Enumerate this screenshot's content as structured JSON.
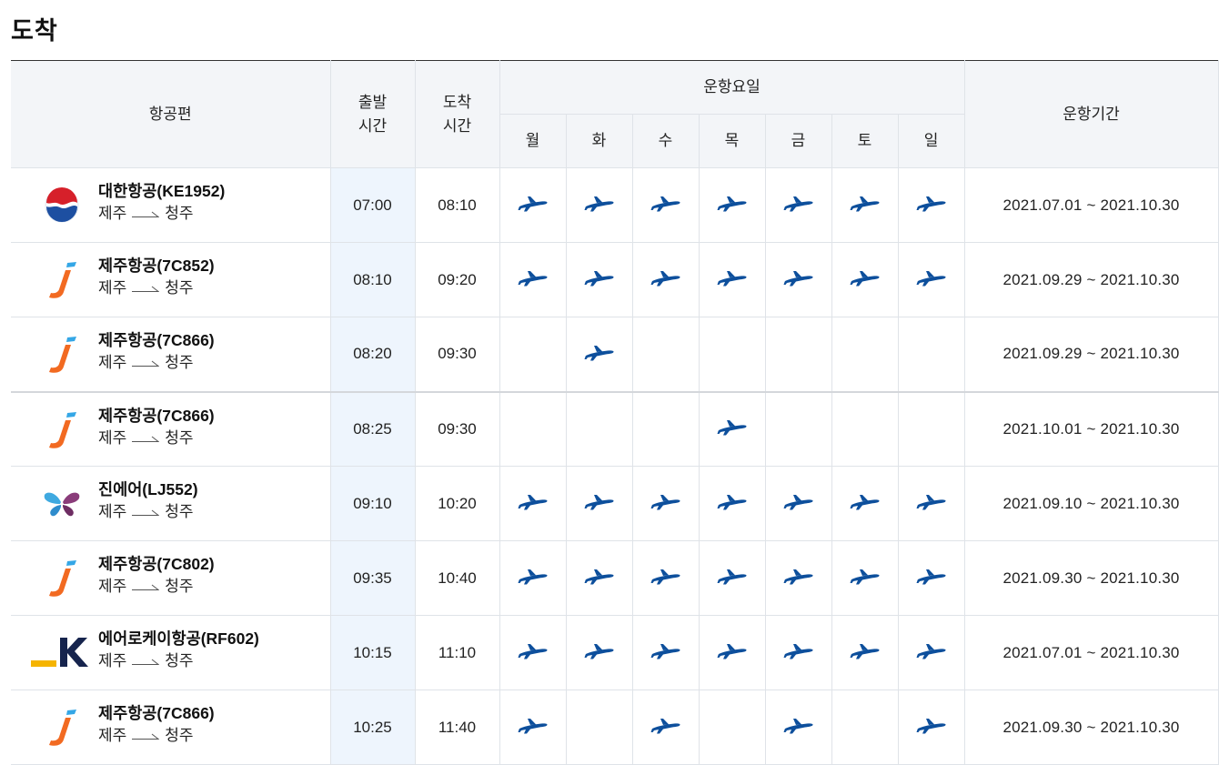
{
  "section_title": "도착",
  "header": {
    "flight": "항공편",
    "dep_line1": "출발",
    "dep_line2": "시간",
    "arr_line1": "도착",
    "arr_line2": "시간",
    "days_group": "운항요일",
    "days": [
      "월",
      "화",
      "수",
      "목",
      "금",
      "토",
      "일"
    ],
    "period": "운항기간"
  },
  "colors": {
    "plane": "#0d4f9c",
    "dep_bg": "#eef5fd",
    "header_bg": "#f3f5f8"
  },
  "rows": [
    {
      "airline_logo": "korean-air-logo",
      "flight": "대한항공(KE1952)",
      "from": "제주",
      "to": "청주",
      "dep": "07:00",
      "arr": "08:10",
      "days": [
        true,
        true,
        true,
        true,
        true,
        true,
        true
      ],
      "period": "2021.07.01 ~ 2021.10.30"
    },
    {
      "airline_logo": "jeju-air-logo",
      "flight": "제주항공(7C852)",
      "from": "제주",
      "to": "청주",
      "dep": "08:10",
      "arr": "09:20",
      "days": [
        true,
        true,
        true,
        true,
        true,
        true,
        true
      ],
      "period": "2021.09.29 ~ 2021.10.30"
    },
    {
      "airline_logo": "jeju-air-logo",
      "flight": "제주항공(7C866)",
      "from": "제주",
      "to": "청주",
      "dep": "08:20",
      "arr": "09:30",
      "days": [
        false,
        true,
        false,
        false,
        false,
        false,
        false
      ],
      "period": "2021.09.29 ~ 2021.10.30"
    },
    {
      "airline_logo": "jeju-air-logo",
      "flight": "제주항공(7C866)",
      "from": "제주",
      "to": "청주",
      "dep": "08:25",
      "arr": "09:30",
      "days": [
        false,
        false,
        false,
        true,
        false,
        false,
        false
      ],
      "period": "2021.10.01 ~ 2021.10.30"
    },
    {
      "airline_logo": "jin-air-logo",
      "flight": "진에어(LJ552)",
      "from": "제주",
      "to": "청주",
      "dep": "09:10",
      "arr": "10:20",
      "days": [
        true,
        true,
        true,
        true,
        true,
        true,
        true
      ],
      "period": "2021.09.10 ~ 2021.10.30"
    },
    {
      "airline_logo": "jeju-air-logo",
      "flight": "제주항공(7C802)",
      "from": "제주",
      "to": "청주",
      "dep": "09:35",
      "arr": "10:40",
      "days": [
        true,
        true,
        true,
        true,
        true,
        true,
        true
      ],
      "period": "2021.09.30 ~ 2021.10.30"
    },
    {
      "airline_logo": "aero-k-logo",
      "flight": "에어로케이항공(RF602)",
      "from": "제주",
      "to": "청주",
      "dep": "10:15",
      "arr": "11:10",
      "days": [
        true,
        true,
        true,
        true,
        true,
        true,
        true
      ],
      "period": "2021.07.01 ~ 2021.10.30"
    },
    {
      "airline_logo": "jeju-air-logo",
      "flight": "제주항공(7C866)",
      "from": "제주",
      "to": "청주",
      "dep": "10:25",
      "arr": "11:40",
      "days": [
        true,
        false,
        true,
        false,
        true,
        false,
        true
      ],
      "period": "2021.09.30 ~ 2021.10.30"
    }
  ]
}
